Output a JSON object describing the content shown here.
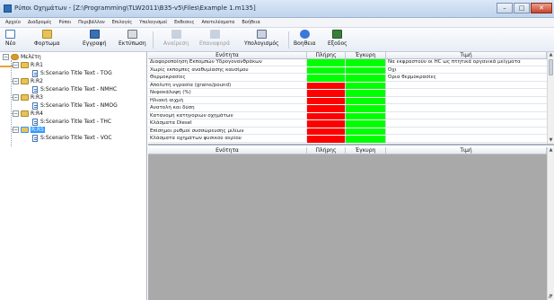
{
  "window": {
    "title": "Ρύποι Οχημάτων - [Z:\\Programming\\TLW2011\\B35-v5\\Files\\Example 1.m135]",
    "minimize": "–",
    "maximize": "□",
    "close": "✕"
  },
  "menu": {
    "items": [
      "Αρχείο",
      "Διαδρομές",
      "Ρύποι",
      "Περιβάλλον",
      "Επιλογές",
      "Υπολογισμοί",
      "Εκθεσεις",
      "Αποτελέσματα",
      "Βοήθεια"
    ]
  },
  "toolbar": {
    "buttons": [
      {
        "label": "Νέο",
        "icon": "new-document-icon",
        "enabled": true
      },
      {
        "label": "Φορτωμα",
        "icon": "open-folder-icon",
        "enabled": true
      },
      {
        "label": "Εγγραφή",
        "icon": "save-disk-icon",
        "enabled": true
      },
      {
        "label": "Εκτύπωση",
        "icon": "printer-icon",
        "enabled": true
      },
      {
        "label": "Αναίρεση",
        "icon": "undo-icon",
        "enabled": false
      },
      {
        "label": "Επαναφορά",
        "icon": "redo-icon",
        "enabled": false
      },
      {
        "label": "Υπολογισμός",
        "icon": "calculator-icon",
        "enabled": true
      },
      {
        "label": "Βοηθεια",
        "icon": "help-icon",
        "enabled": true
      },
      {
        "label": "Εξοδος",
        "icon": "exit-icon",
        "enabled": true
      }
    ]
  },
  "tree": {
    "root": "Μελέτη",
    "nodes": [
      {
        "label": "R:R1",
        "child": "S:Scenario Title Text - TOG"
      },
      {
        "label": "R:R2",
        "child": "S:Scenario Title Text - NMHC"
      },
      {
        "label": "R:R3",
        "child": "S:Scenario Title Text - NMOG"
      },
      {
        "label": "R:R4",
        "child": "S:Scenario Title Text - THC"
      },
      {
        "label": "R:R5",
        "child": "S:Scenario Title Text - VOC",
        "selected": true
      }
    ]
  },
  "grid_top": {
    "headers": {
      "name": "Ενότητα",
      "full": "Πλήρης",
      "valid": "Έγκυρη",
      "value": "Τιμή"
    },
    "rows": [
      {
        "name": "Διαφοροποίηση Εκπομπών Υδρογονανθράκων",
        "full": "green",
        "valid": "green",
        "value": "Να εκφραστούν οι HC ως πτητικά οργανικά μείγματα"
      },
      {
        "name": "Χωρίς εκπομπές αναθυμίασης καυσίμου",
        "full": "green",
        "valid": "green",
        "value": "Όχι"
      },
      {
        "name": "Θερμοκρασίες",
        "full": "green",
        "valid": "green",
        "value": "Όρια θερμοκρασίες"
      },
      {
        "name": "Απόλυτη υγρασία (grains/pound)",
        "full": "red",
        "valid": "green",
        "value": ""
      },
      {
        "name": "Νεφοκάλυψη (%)",
        "full": "red",
        "valid": "green",
        "value": ""
      },
      {
        "name": "Ηλιακή αιχμή",
        "full": "red",
        "valid": "green",
        "value": ""
      },
      {
        "name": "Ανατολή και δύση",
        "full": "red",
        "valid": "green",
        "value": ""
      },
      {
        "name": "Κατανομή κατηγοριών οχημάτων",
        "full": "red",
        "valid": "green",
        "value": ""
      },
      {
        "name": "Κλάσματα Diesel",
        "full": "red",
        "valid": "green",
        "value": ""
      },
      {
        "name": "Επίσημοι ρυθμοί συσσώρευσης μιλίων",
        "full": "red",
        "valid": "green",
        "value": ""
      },
      {
        "name": "Κλάσματα οχημάτων φυσικού αερίου",
        "full": "red",
        "valid": "green",
        "value": ""
      }
    ]
  },
  "grid_bottom": {
    "headers": {
      "name": "Ενότητα",
      "full": "Πλήρης",
      "valid": "Έγκυρη",
      "value": "Τιμή"
    }
  },
  "colors": {
    "green": "#00ff00",
    "red": "#ff0000",
    "selection": "#3399ff",
    "empty_area": "#a9a9a9"
  },
  "scroll": {
    "up": "▲",
    "down": "▼"
  }
}
